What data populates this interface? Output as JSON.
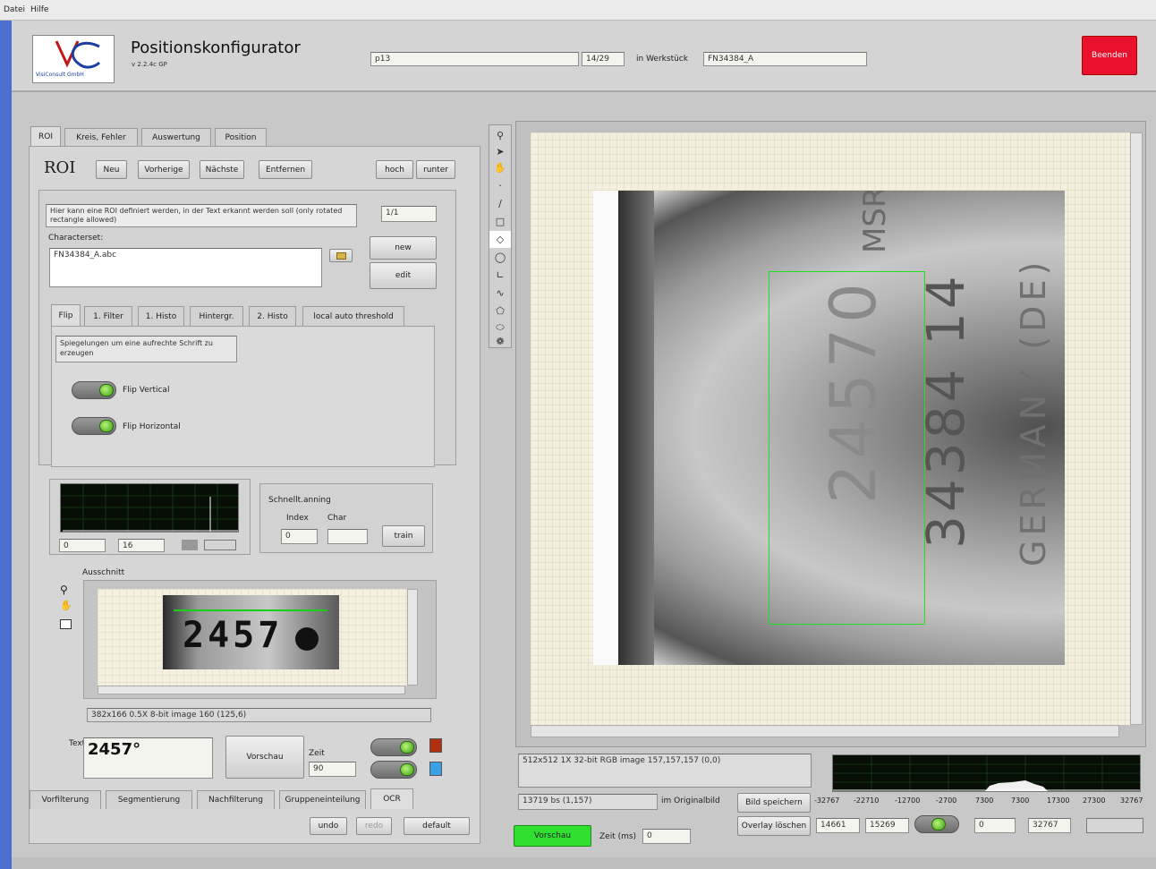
{
  "menu": [
    "Datei",
    "Hilfe"
  ],
  "header": {
    "logo_company": "VisiConsult GmbH",
    "title": "Positionskonfigurator",
    "version": "v 2.2.4c GP",
    "field_name": "p13",
    "field_count": "14/29",
    "workpiece_label": "in Werkstück",
    "workpiece_value": "FN34384_A",
    "quit_button": "Beenden"
  },
  "main_tabs": [
    "ROI",
    "Kreis, Fehler",
    "Auswertung",
    "Position"
  ],
  "roi": {
    "heading": "ROI",
    "buttons": [
      "Neu",
      "Vorherige",
      "Nächste",
      "Entfernen"
    ],
    "up": "hoch",
    "down": "runter",
    "description": "Hier kann eine ROI definiert werden, in der Text erkannt werden soll (only rotated rectangle allowed)",
    "ratio": "1/1",
    "charset_label": "Characterset:",
    "charset_value": "FN34384_A.abc",
    "new_button": "new",
    "edit_button": "edit",
    "sub_tabs": [
      "Flip",
      "1. Filter",
      "1. Histo",
      "Hintergr.",
      "2. Histo",
      "local auto threshold"
    ],
    "flip_hint": "Spiegelungen um eine aufrechte Schrift zu erzeugen",
    "flip_vertical": "Flip Vertical",
    "flip_horizontal": "Flip Horizontal",
    "hist_min": "0",
    "hist_max": "16",
    "schnell_label": "Schnellt.anning",
    "index_label": "Index",
    "char_label": "Char",
    "index_value": "0",
    "train_button": "train",
    "ausschnitt_label": "Ausschnitt",
    "crop_text": "2457",
    "crop_info": "382x166 0.5X 8-bit image 160 (125,6)",
    "text_label": "Text",
    "text_value": "2457°",
    "preview_button": "Vorschau",
    "zeit_label": "Zeit",
    "zeit_value": "90",
    "status_red": "#b03010",
    "status_blue": "#3aa0e8"
  },
  "bottom_tabs": [
    "Vorfilterung",
    "Segmentierung",
    "Nachfilterung",
    "Gruppeneinteilung",
    "OCR"
  ],
  "bottom_buttons": {
    "undo": "undo",
    "redo": "redo",
    "default": "default"
  },
  "image_info": "512x512 1X 32-bit RGB image 157,157,157 (0,0)",
  "status_info": "13719 bs (1,157)",
  "original_label": "im Originalbild",
  "save_button": "Bild speichern",
  "overlay_button": "Overlay löschen",
  "preview_button": "Vorschau",
  "zeit_ms_label": "Zeit (ms)",
  "zeit_ms_value": "0",
  "hist_axis": [
    "-32767",
    "-22710",
    "-12700",
    "-2700",
    "7300",
    "7300",
    "17300",
    "27300",
    "32767"
  ],
  "range_min": "14661",
  "range_max": "15269",
  "range_low": "0",
  "range_high": "32767",
  "main_image": {
    "line1": "MSR",
    "line2": "24570",
    "line3": "34384 14",
    "line4": "GERMANY (DE)"
  }
}
